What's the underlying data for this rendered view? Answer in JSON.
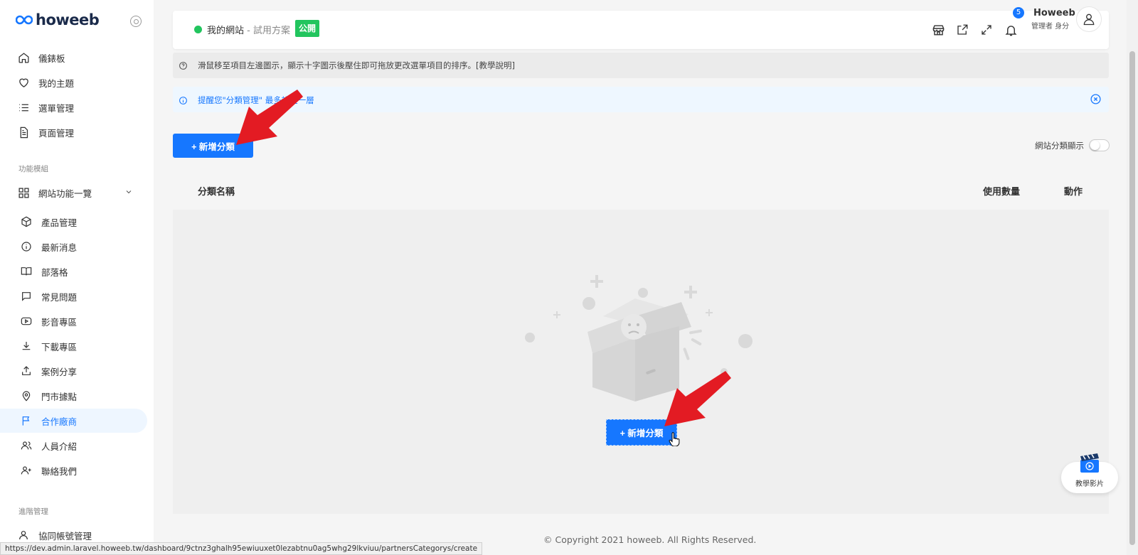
{
  "brand": {
    "name": "howeeb"
  },
  "sidebar": {
    "top_items": [
      {
        "label": "儀錶板",
        "icon": "home-icon"
      },
      {
        "label": "我的主題",
        "icon": "heart-icon"
      },
      {
        "label": "選單管理",
        "icon": "list-icon"
      },
      {
        "label": "頁面管理",
        "icon": "document-icon"
      }
    ],
    "section_modules": "功能模組",
    "modules_group": "網站功能一覽",
    "module_items": [
      {
        "label": "產品管理",
        "icon": "box-icon"
      },
      {
        "label": "最新消息",
        "icon": "info-icon"
      },
      {
        "label": "部落格",
        "icon": "book-icon"
      },
      {
        "label": "常見問題",
        "icon": "chat-icon"
      },
      {
        "label": "影音專區",
        "icon": "video-icon"
      },
      {
        "label": "下載專區",
        "icon": "download-icon"
      },
      {
        "label": "案例分享",
        "icon": "share-icon"
      },
      {
        "label": "門市據點",
        "icon": "location-pin-icon"
      },
      {
        "label": "合作廠商",
        "icon": "flag-icon",
        "active": true
      },
      {
        "label": "人員介紹",
        "icon": "users-icon"
      },
      {
        "label": "聯絡我們",
        "icon": "user-plus-icon"
      }
    ],
    "section_advanced": "進階管理",
    "advanced_items": [
      {
        "label": "協同帳號管理",
        "icon": "user-icon"
      }
    ]
  },
  "topbar": {
    "site_name": "我的網站",
    "site_plan": " - 試用方案",
    "public_badge": "公開",
    "notification_count": "5",
    "user_name": "Howeeb",
    "user_role": "管理者 身分"
  },
  "tip": {
    "text": "滑鼠移至項目左邊圖示，顯示十字圖示後壓住即可拖放更改選單項目的排序。[教學說明]"
  },
  "alert": {
    "text": "提醒您\"分類管理\" 最多設定一層"
  },
  "actions": {
    "add_category": "+ 新增分類"
  },
  "toggle": {
    "label": "網站分類顯示"
  },
  "table": {
    "columns": [
      "分類名稱",
      "使用數量",
      "動作"
    ]
  },
  "empty_state": {
    "add_button": "+ 新增分類"
  },
  "footer": {
    "copyright": "© Copyright 2021 howeeb. All Rights Reserved."
  },
  "status_url": "https://dev.admin.laravel.howeeb.tw/dashboard/9ctnz3ghalh95ewiuuxet0lezabtnu0ag5whg29lkviuu/partnersCategorys/create",
  "tutorial": {
    "label": "教學影片"
  },
  "colors": {
    "primary": "#1677ff",
    "success": "#22c55e",
    "arrow": "#e31b23"
  }
}
